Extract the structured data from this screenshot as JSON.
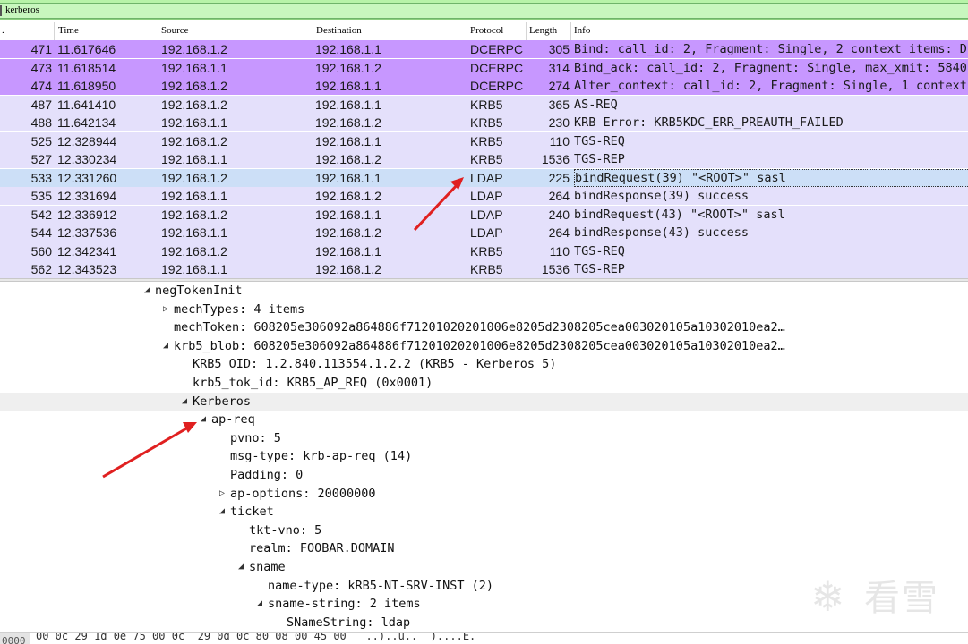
{
  "filter": {
    "value": "kerberos"
  },
  "columns": {
    "no": ".",
    "time": "Time",
    "source": "Source",
    "destination": "Destination",
    "protocol": "Protocol",
    "length": "Length",
    "info": "Info"
  },
  "packets": [
    {
      "no": "471",
      "time": "11.617646",
      "src": "192.168.1.2",
      "dst": "192.168.1.1",
      "proto": "DCERPC",
      "len": "305",
      "info": "Bind: call_id: 2, Fragment: Single, 2 context items: D",
      "style": "dce"
    },
    {
      "no": "473",
      "time": "11.618514",
      "src": "192.168.1.1",
      "dst": "192.168.1.2",
      "proto": "DCERPC",
      "len": "314",
      "info": "Bind_ack: call_id: 2, Fragment: Single, max_xmit: 5840",
      "style": "dce"
    },
    {
      "no": "474",
      "time": "11.618950",
      "src": "192.168.1.2",
      "dst": "192.168.1.1",
      "proto": "DCERPC",
      "len": "274",
      "info": "Alter_context: call_id: 2, Fragment: Single, 1 context",
      "style": "dce"
    },
    {
      "no": "487",
      "time": "11.641410",
      "src": "192.168.1.2",
      "dst": "192.168.1.1",
      "proto": "KRB5",
      "len": "365",
      "info": "AS-REQ",
      "style": "krb"
    },
    {
      "no": "488",
      "time": "11.642134",
      "src": "192.168.1.1",
      "dst": "192.168.1.2",
      "proto": "KRB5",
      "len": "230",
      "info": "KRB Error: KRB5KDC_ERR_PREAUTH_FAILED",
      "style": "krb"
    },
    {
      "no": "525",
      "time": "12.328944",
      "src": "192.168.1.2",
      "dst": "192.168.1.1",
      "proto": "KRB5",
      "len": "110",
      "info": "TGS-REQ",
      "style": "krb"
    },
    {
      "no": "527",
      "time": "12.330234",
      "src": "192.168.1.1",
      "dst": "192.168.1.2",
      "proto": "KRB5",
      "len": "1536",
      "info": "TGS-REP",
      "style": "krb"
    },
    {
      "no": "533",
      "time": "12.331260",
      "src": "192.168.1.2",
      "dst": "192.168.1.1",
      "proto": "LDAP",
      "len": "225",
      "info": "bindRequest(39) \"<ROOT>\" sasl",
      "style": "sel"
    },
    {
      "no": "535",
      "time": "12.331694",
      "src": "192.168.1.1",
      "dst": "192.168.1.2",
      "proto": "LDAP",
      "len": "264",
      "info": "bindResponse(39) success",
      "style": "krb"
    },
    {
      "no": "542",
      "time": "12.336912",
      "src": "192.168.1.2",
      "dst": "192.168.1.1",
      "proto": "LDAP",
      "len": "240",
      "info": "bindRequest(43) \"<ROOT>\" sasl",
      "style": "krb"
    },
    {
      "no": "544",
      "time": "12.337536",
      "src": "192.168.1.1",
      "dst": "192.168.1.2",
      "proto": "LDAP",
      "len": "264",
      "info": "bindResponse(43) success",
      "style": "krb"
    },
    {
      "no": "560",
      "time": "12.342341",
      "src": "192.168.1.2",
      "dst": "192.168.1.1",
      "proto": "KRB5",
      "len": "110",
      "info": "TGS-REQ",
      "style": "krb"
    },
    {
      "no": "562",
      "time": "12.343523",
      "src": "192.168.1.1",
      "dst": "192.168.1.2",
      "proto": "KRB5",
      "len": "1536",
      "info": "TGS-REP",
      "style": "krb"
    }
  ],
  "tree": [
    {
      "text": "negTokenInit",
      "toggle": "◢",
      "level": 0
    },
    {
      "text": "mechTypes: 4 items",
      "toggle": "▷",
      "level": 1
    },
    {
      "text": "mechToken: 608205e306092a864886f71201020201006e8205d2308205cea003020105a10302010ea2…",
      "toggle": "",
      "level": 1
    },
    {
      "text": "krb5_blob: 608205e306092a864886f71201020201006e8205d2308205cea003020105a10302010ea2…",
      "toggle": "◢",
      "level": 1
    },
    {
      "text": "KRB5 OID: 1.2.840.113554.1.2.2 (KRB5 - Kerberos 5)",
      "toggle": "",
      "level": 2
    },
    {
      "text": "krb5_tok_id: KRB5_AP_REQ (0x0001)",
      "toggle": "",
      "level": 2
    },
    {
      "text": "Kerberos",
      "toggle": "◢",
      "level": 2,
      "hl": true
    },
    {
      "text": "ap-req",
      "toggle": "◢",
      "level": 3
    },
    {
      "text": "pvno: 5",
      "toggle": "",
      "level": 4
    },
    {
      "text": "msg-type: krb-ap-req (14)",
      "toggle": "",
      "level": 4
    },
    {
      "text": "Padding: 0",
      "toggle": "",
      "level": 4
    },
    {
      "text": "ap-options: 20000000",
      "toggle": "▷",
      "level": 4
    },
    {
      "text": "ticket",
      "toggle": "◢",
      "level": 4
    },
    {
      "text": "tkt-vno: 5",
      "toggle": "",
      "level": 5
    },
    {
      "text": "realm: FOOBAR.DOMAIN",
      "toggle": "",
      "level": 5
    },
    {
      "text": "sname",
      "toggle": "◢",
      "level": 5
    },
    {
      "text": "name-type: kRB5-NT-SRV-INST (2)",
      "toggle": "",
      "level": 6
    },
    {
      "text": "sname-string: 2 items",
      "toggle": "◢",
      "level": 6
    },
    {
      "text": "SNameString: ldap",
      "toggle": "",
      "level": 7
    }
  ],
  "hex": {
    "offset": "0000",
    "text": "00 0c 29 1d 0e 75 00 0c  29 0d 0c 80 08 00 45 00   ..)..u..  )....E."
  },
  "watermark": {
    "glyph": "❄",
    "text": "看雪"
  },
  "colors": {
    "dcerpc_row": "#c797ff",
    "krb_row": "#e4e0fb",
    "selected_row": "#ccdff7",
    "filter_ok": "#b7f3a8",
    "annotation_arrow": "#e02020"
  }
}
